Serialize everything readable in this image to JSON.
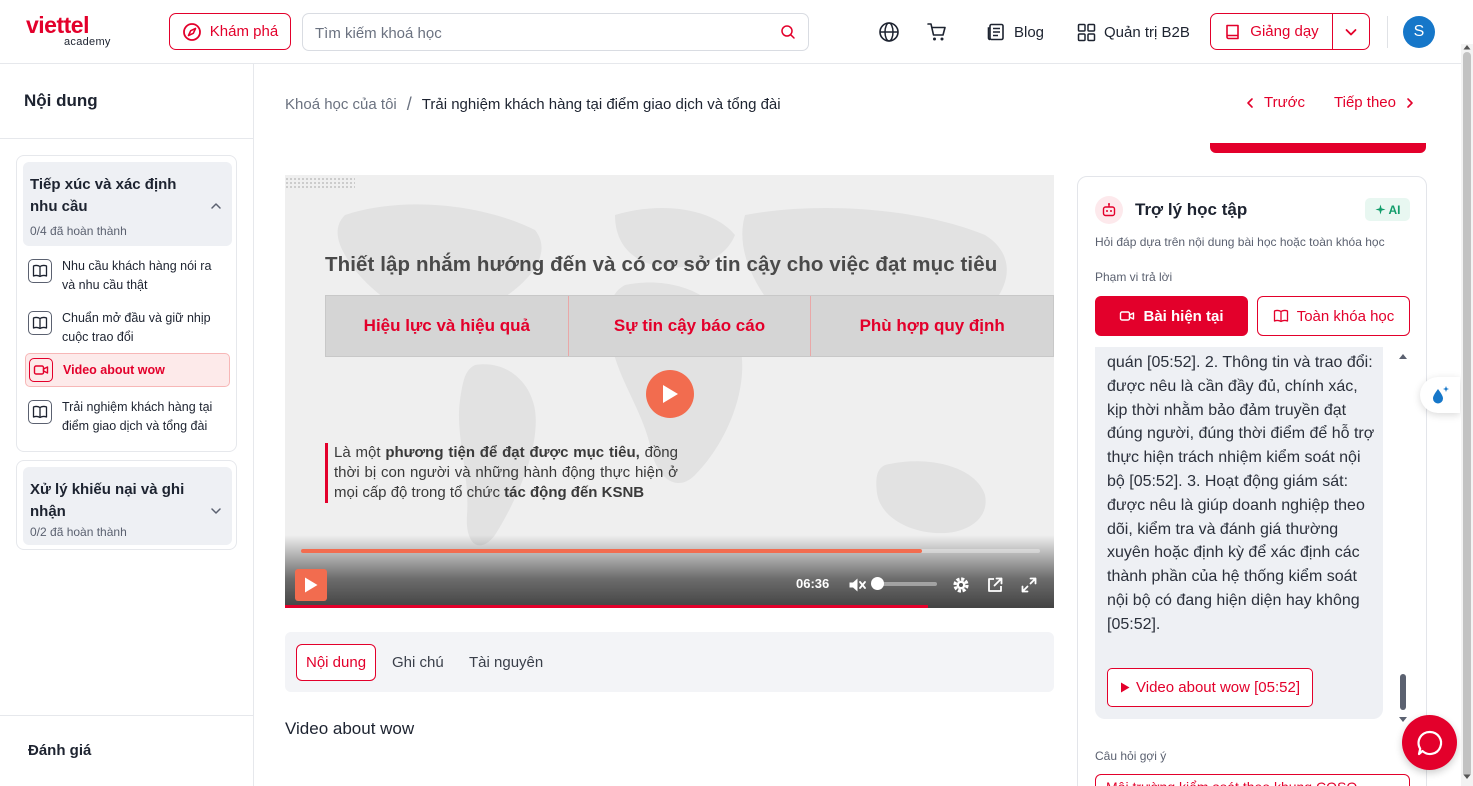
{
  "header": {
    "logo_brand": "viettel",
    "logo_sub": "academy",
    "explore_label": "Khám phá",
    "search_placeholder": "Tìm kiếm khoá học",
    "blog_label": "Blog",
    "b2b_label": "Quản trị B2B",
    "teach_label": "Giảng dạy",
    "avatar_initial": "S"
  },
  "sidebar": {
    "title": "Nội dung",
    "sections": [
      {
        "title": "Tiếp xúc và xác định nhu cầu",
        "progress": "0/4 đã hoàn thành",
        "expanded": true,
        "lessons": [
          {
            "label": "Nhu cầu khách hàng nói ra và nhu cầu thật",
            "icon": "book-icon"
          },
          {
            "label": "Chuẩn mở đầu và giữ nhịp cuộc trao đổi",
            "icon": "book-icon"
          },
          {
            "label": "Video about wow",
            "icon": "video-icon",
            "active": true
          },
          {
            "label": "Trải nghiệm khách hàng tại điểm giao dịch và tổng đài",
            "icon": "book-icon"
          }
        ]
      },
      {
        "title": "Xử lý khiếu nại và ghi nhận",
        "progress": "0/2 đã hoàn thành",
        "expanded": false
      }
    ],
    "evaluation_label": "Đánh giá"
  },
  "breadcrumb": {
    "parent": "Khoá học của tôi",
    "current": "Trải nghiệm khách hàng tại điểm giao dịch và tổng đài"
  },
  "nav": {
    "prev_label": "Trước",
    "next_label": "Tiếp theo"
  },
  "video": {
    "slide_title": "Thiết lập nhắm hướng đến và có cơ sở tin cậy cho việc đạt mục tiêu",
    "cells": [
      "Hiệu lực và hiệu quả",
      "Sự tin cậy báo cáo",
      "Phù hợp quy định"
    ],
    "quote_p1": "Là một ",
    "quote_b1": "phương tiện để đạt được mục tiêu,",
    "quote_p2": " đồng thời bị con người và những hành động thực hiện ở mọi cấp độ trong tổ chức ",
    "quote_b2": "tác động đến KSNB",
    "time": "06:36",
    "progress_fraction": 0.84,
    "volume_fraction": 0.0
  },
  "tabs": [
    "Nội dung",
    "Ghi chú",
    "Tài nguyên"
  ],
  "active_tab": 0,
  "content_title": "Video about wow",
  "assistant": {
    "title": "Trợ lý học tập",
    "ai_badge": "AI",
    "subtitle": "Hỏi đáp dựa trên nội dung bài học hoặc toàn khóa học",
    "scope_label": "Phạm vi trả lời",
    "scope_current": "Bài hiện tại",
    "scope_all": "Toàn khóa học",
    "answer_text": "quán [05:52]. 2. Thông tin và trao đổi: được nêu là cần đầy đủ, chính xác, kịp thời nhằm bảo đảm truyền đạt đúng người, đúng thời điểm để hỗ trợ thực hiện trách nhiệm kiểm soát nội bộ [05:52]. 3. Hoạt động giám sát: được nêu là giúp doanh nghiệp theo dõi, kiểm tra và đánh giá thường xuyên hoặc định kỳ để xác định các thành phần của hệ thống kiểm soát nội bộ có đang hiện diện hay không [05:52].",
    "answer_ref": "Video about wow [05:52]",
    "suggest_label": "Câu hỏi gợi ý",
    "suggest_item": "Môi trường kiểm soát theo khung COSO"
  },
  "colors": {
    "brand_red": "#e3002b",
    "video_accent": "#f26c4f",
    "avatar_blue": "#1677c9",
    "ai_green": "#129d6b"
  }
}
